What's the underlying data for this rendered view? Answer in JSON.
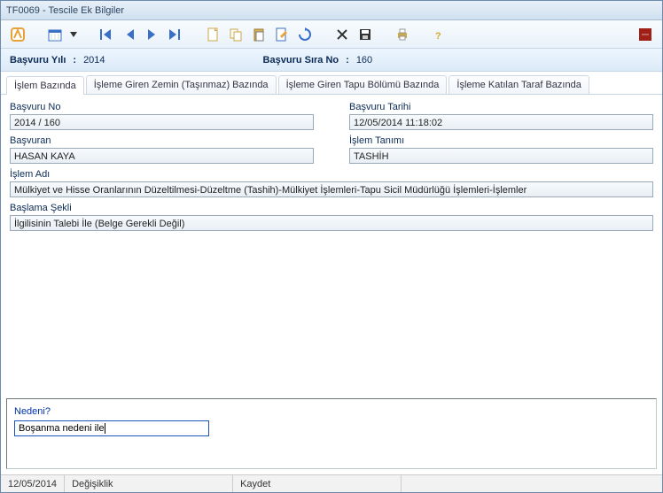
{
  "window": {
    "title": "TF0069 - Tescile Ek Bilgiler"
  },
  "header": {
    "year_label": "Başvuru Yılı",
    "year_value": "2014",
    "seq_label": "Başvuru Sıra No",
    "seq_value": "160"
  },
  "tabs": [
    {
      "label": "İşlem Bazında"
    },
    {
      "label": "İşleme Giren Zemin (Taşınmaz) Bazında"
    },
    {
      "label": "İşleme Giren Tapu Bölümü Bazında"
    },
    {
      "label": "İşleme Katılan Taraf Bazında"
    }
  ],
  "form": {
    "basvuru_no_label": "Başvuru No",
    "basvuru_no_value": "2014 / 160",
    "basvuru_tarihi_label": "Başvuru Tarihi",
    "basvuru_tarihi_value": "12/05/2014 11:18:02",
    "basvuran_label": "Başvuran",
    "basvuran_value": "HASAN KAYA",
    "islem_tanimi_label": "İşlem Tanımı",
    "islem_tanimi_value": "TASHİH",
    "islem_adi_label": "İşlem Adı",
    "islem_adi_value": "Mülkiyet ve Hisse Oranlarının Düzeltilmesi-Düzeltme (Tashih)-Mülkiyet İşlemleri-Tapu Sicil Müdürlüğü İşlemleri-İşlemler",
    "baslama_sekli_label": "Başlama Şekli",
    "baslama_sekli_value": "İlgilisinin Talebi İle (Belge Gerekli Değil)"
  },
  "bottom": {
    "nedeni_label": "Nedeni?",
    "nedeni_value": "Boşanma nedeni ile"
  },
  "status": {
    "date": "12/05/2014",
    "mode": "Değişiklik",
    "action": "Kaydet"
  },
  "icons": {
    "app": "app-logo-icon",
    "calendar": "calendar-icon",
    "dropdown": "chevron-down-icon",
    "first": "nav-first-icon",
    "prev": "nav-prev-icon",
    "next": "nav-next-icon",
    "last": "nav-last-icon",
    "new": "new-doc-icon",
    "copy": "copy-icon",
    "paste": "paste-icon",
    "edit": "edit-doc-icon",
    "refresh": "refresh-icon",
    "delete": "delete-x-icon",
    "save": "save-floppy-icon",
    "print": "print-icon",
    "help": "help-icon",
    "close": "close-red-icon"
  }
}
